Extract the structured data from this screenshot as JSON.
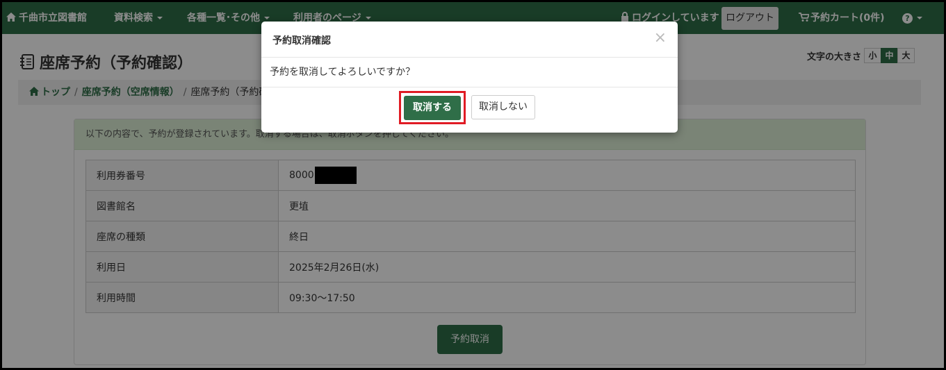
{
  "navbar": {
    "home_label": "千曲市立図書館",
    "search_label": "資料検索",
    "lists_label": "各種一覧･その他",
    "user_page_label": "利用者のページ",
    "login_status": "ログインしています",
    "logout_label": "ログアウト",
    "cart_label": "予約カート(0件)",
    "help_label": "?"
  },
  "page": {
    "title": "座席予約（予約確認）",
    "font_size_label": "文字の大きさ",
    "font_sizes": [
      "小",
      "中",
      "大"
    ],
    "breadcrumb": {
      "top": "トップ",
      "seat_vacancy": "座席予約（空席情報）",
      "current": "座席予約（予約確認）"
    },
    "alert": "以下の内容で、予約が登録されています。取消する場合は、取消ボタンを押してください。",
    "table": [
      {
        "key": "利用券番号",
        "value": "8000"
      },
      {
        "key": "図書館名",
        "value": "更埴"
      },
      {
        "key": "座席の種類",
        "value": "終日"
      },
      {
        "key": "利用日",
        "value": "2025年2月26日(水)"
      },
      {
        "key": "利用時間",
        "value": "09:30～17:50"
      }
    ],
    "cancel_reservation_label": "予約取消"
  },
  "modal": {
    "title": "予約取消確認",
    "close": "×",
    "message": "予約を取消してよろしいですか？",
    "confirm_label": "取消する",
    "decline_label": "取消しない"
  },
  "colors": {
    "brand_green": "#2f6e48",
    "highlight_red": "#e01b24",
    "alert_bg": "#dff0d8"
  }
}
